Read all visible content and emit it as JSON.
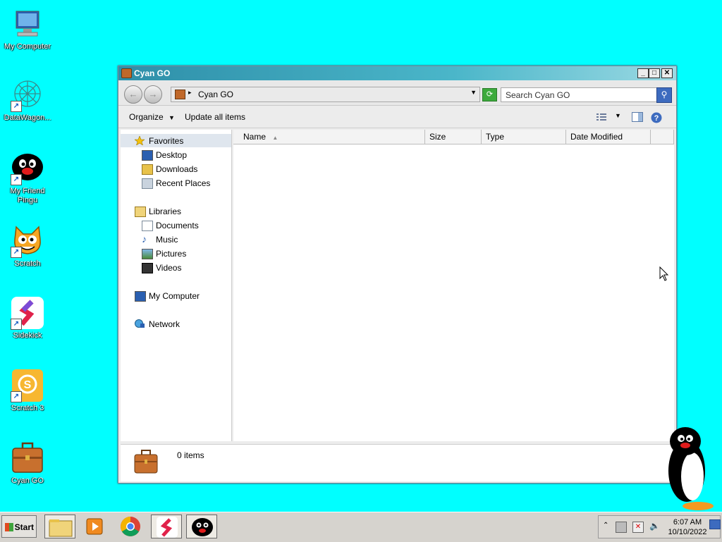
{
  "desktop": {
    "icons": [
      {
        "label": "My Computer"
      },
      {
        "label": "DataWagon..."
      },
      {
        "label": "My Friend Pingu"
      },
      {
        "label": "Scratch"
      },
      {
        "label": "Sidekick"
      },
      {
        "label": "Scratch 3"
      },
      {
        "label": "Cyan GO"
      }
    ],
    "background_color": "#00ffff"
  },
  "window": {
    "title": "Cyan GO",
    "address": "Cyan GO",
    "search_placeholder": "Search Cyan GO",
    "commands": {
      "organize": "Organize",
      "update": "Update all items"
    },
    "nav": {
      "favorites": "Favorites",
      "desktop": "Desktop",
      "downloads": "Downloads",
      "recent": "Recent Places",
      "libraries": "Libraries",
      "documents": "Documents",
      "music": "Music",
      "pictures": "Pictures",
      "videos": "Videos",
      "computer": "My Computer",
      "network": "Network"
    },
    "columns": {
      "name": "Name",
      "size": "Size",
      "type": "Type",
      "date": "Date Modified"
    },
    "status": "0 items"
  },
  "taskbar": {
    "start": "Start",
    "time": "6:07 AM",
    "date": "10/10/2022"
  }
}
